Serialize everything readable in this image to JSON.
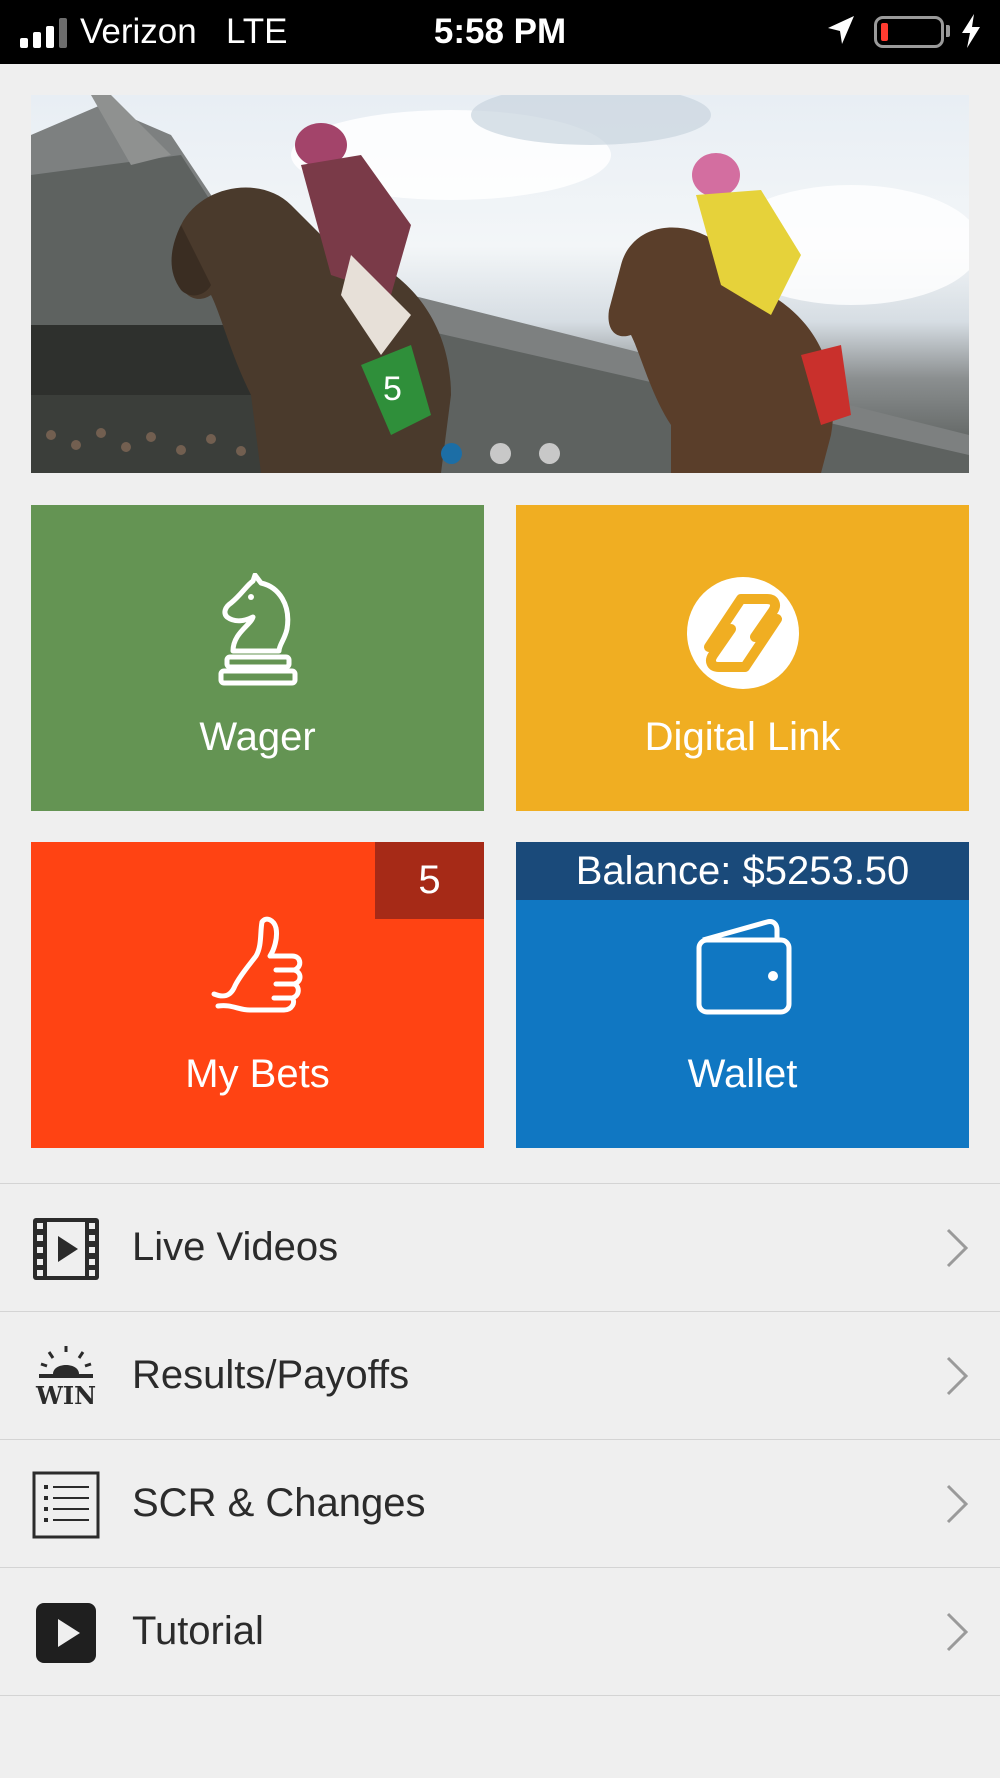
{
  "status_bar": {
    "carrier": "Verizon",
    "network": "LTE",
    "time": "5:58 PM"
  },
  "banner": {
    "slide_count": 3,
    "active_slide": 1
  },
  "tiles": {
    "wager": {
      "label": "Wager",
      "color": "#649453",
      "icon": "chess-knight-icon"
    },
    "digital_link": {
      "label": "Digital Link",
      "color": "#f0ae22",
      "icon": "digital-link-logo-icon"
    },
    "my_bets": {
      "label": "My Bets",
      "color": "#ff4313",
      "icon": "thumbs-up-icon",
      "badge": "5"
    },
    "wallet": {
      "label": "Wallet",
      "color": "#1077c2",
      "icon": "wallet-icon",
      "balance": "Balance: $5253.50"
    }
  },
  "menu": [
    {
      "label": "Live Videos",
      "icon": "film-play-icon"
    },
    {
      "label": "Results/Payoffs",
      "icon": "win-alarm-icon"
    },
    {
      "label": "SCR & Changes",
      "icon": "list-icon"
    },
    {
      "label": "Tutorial",
      "icon": "play-button-icon"
    }
  ]
}
